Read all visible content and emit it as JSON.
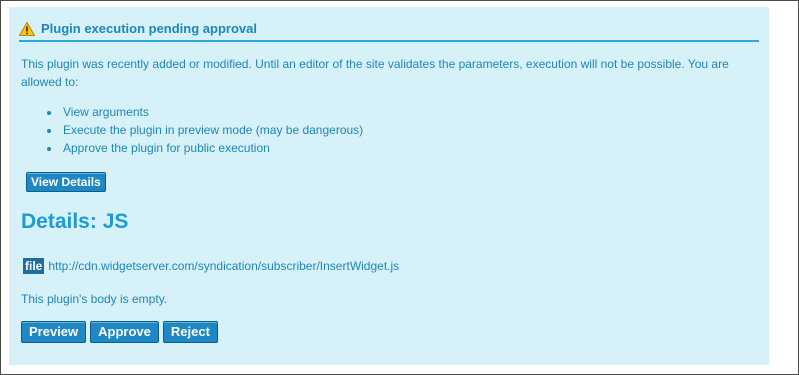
{
  "header": {
    "icon": "warning-icon",
    "title": "Plugin execution pending approval"
  },
  "intro": "This plugin was recently added or modified. Until an editor of the site validates the parameters, execution will not be possible. You are allowed to:",
  "options": [
    "View arguments",
    "Execute the plugin in preview mode (may be dangerous)",
    "Approve the plugin for public execution"
  ],
  "view_details_label": "View Details",
  "details_heading": "Details: JS",
  "file": {
    "badge": "file",
    "url": "http://cdn.widgetserver.com/syndication/subscriber/InsertWidget.js"
  },
  "body_empty_msg": "This plugin's body is empty.",
  "actions": {
    "preview": "Preview",
    "approve": "Approve",
    "reject": "Reject"
  },
  "colors": {
    "panel_bg": "#d6f1f8",
    "text": "#1f86b8",
    "accent": "#2ea9d7",
    "button": "#1e88c4",
    "warning": "#f5c518"
  }
}
